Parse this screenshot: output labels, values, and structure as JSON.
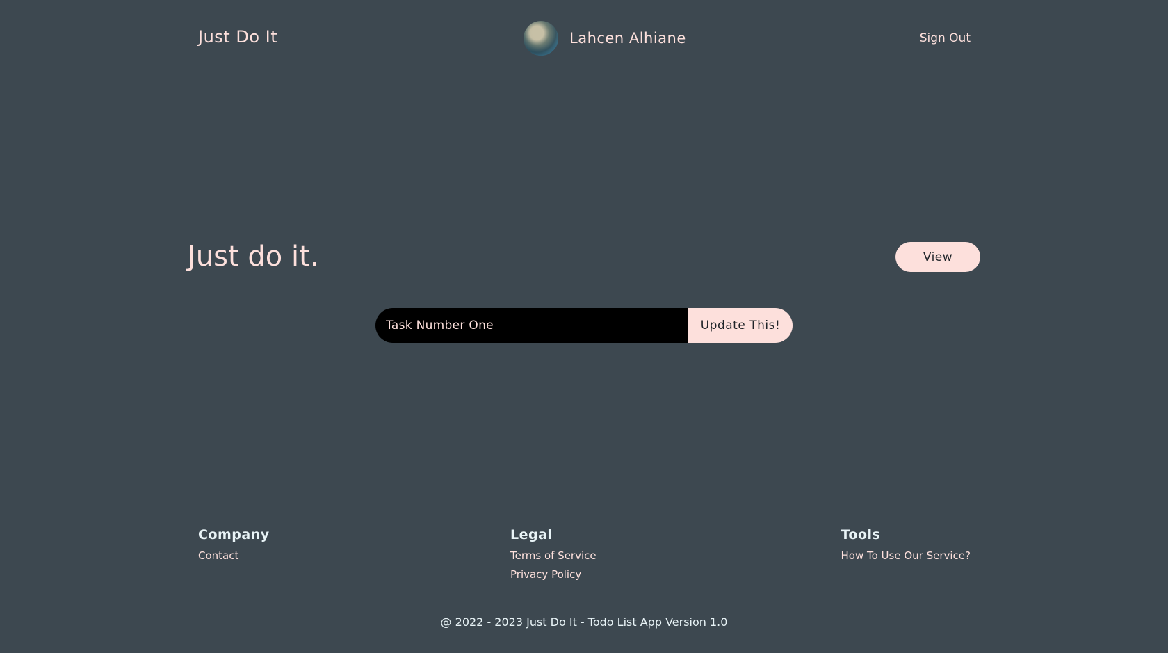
{
  "header": {
    "brand": "Just Do It",
    "user_name": "Lahcen Alhiane",
    "sign_out_label": "Sign Out"
  },
  "main": {
    "heading": "Just do it.",
    "view_button_label": "View",
    "task_input_value": "Task Number One",
    "update_button_label": "Update This!"
  },
  "footer": {
    "columns": [
      {
        "title": "Company",
        "links": [
          "Contact"
        ]
      },
      {
        "title": "Legal",
        "links": [
          "Terms of Service",
          "Privacy Policy"
        ]
      },
      {
        "title": "Tools",
        "links": [
          "How To Use Our Service?"
        ]
      }
    ],
    "copyright": "@ 2022 - 2023 Just Do It - Todo List App Version 1.0"
  },
  "colors": {
    "background": "#3d4850",
    "accent": "#fde0dc",
    "input_background": "#000000",
    "divider": "#d9dde0"
  }
}
